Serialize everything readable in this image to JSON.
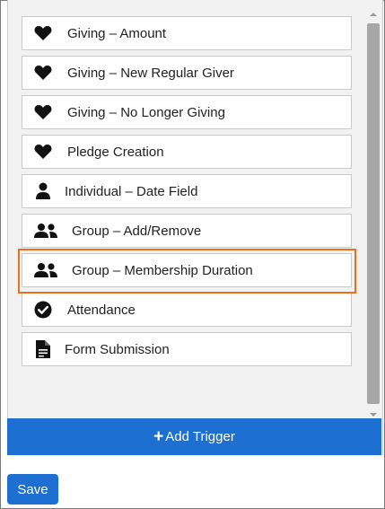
{
  "triggers": [
    {
      "label": "Giving – Amount",
      "icon": "heart-icon"
    },
    {
      "label": "Giving – New Regular Giver",
      "icon": "heart-icon"
    },
    {
      "label": "Giving – No Longer Giving",
      "icon": "heart-icon"
    },
    {
      "label": "Pledge Creation",
      "icon": "heart-icon"
    },
    {
      "label": "Individual – Date Field",
      "icon": "person-icon"
    },
    {
      "label": "Group – Add/Remove",
      "icon": "group-icon"
    },
    {
      "label": "Group – Membership Duration",
      "icon": "group-icon"
    },
    {
      "label": "Attendance",
      "icon": "check-circle-icon"
    },
    {
      "label": "Form Submission",
      "icon": "document-icon"
    }
  ],
  "add_trigger_label": "Add Trigger",
  "save_label": "Save",
  "colors": {
    "primary": "#1e6fd2",
    "highlight": "#ec6f1e",
    "panel_bg": "#f2f2f2"
  }
}
